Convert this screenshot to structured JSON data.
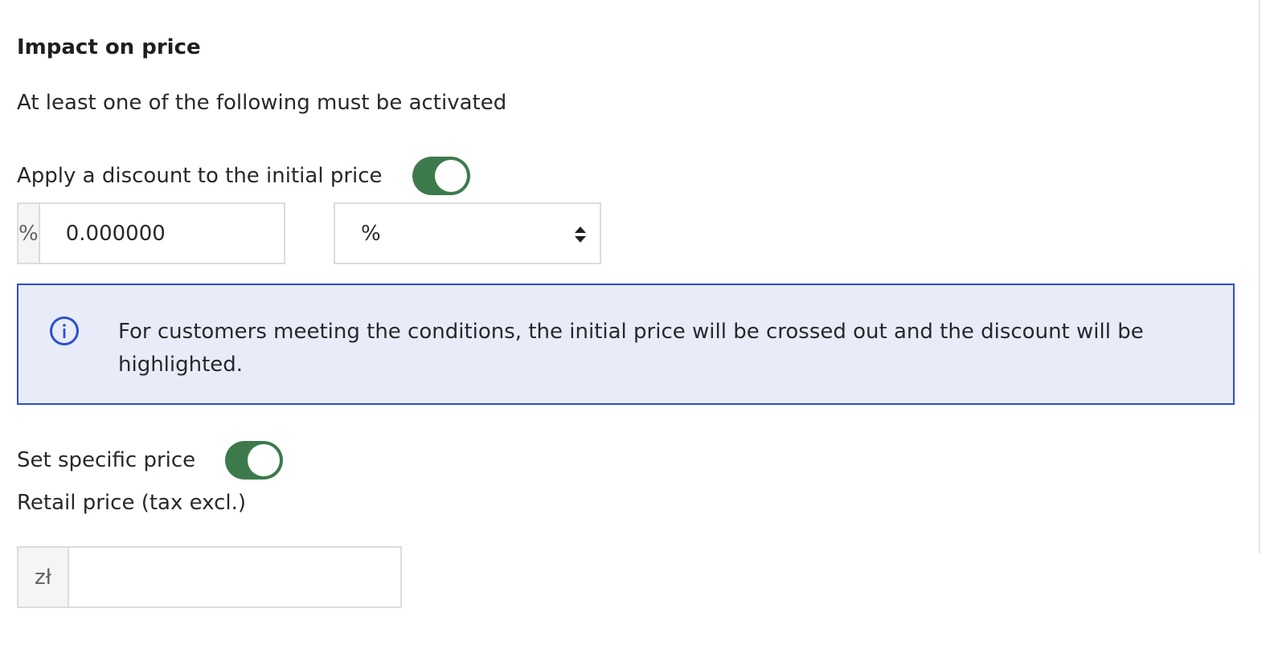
{
  "section": {
    "title": "Impact on price",
    "helper": "At least one of the following must be activated"
  },
  "discount": {
    "label": "Apply a discount to the initial price",
    "enabled": true,
    "addon": "%",
    "value": "0.000000",
    "type_selected": "%"
  },
  "alert": {
    "icon": "info-icon",
    "text": "For customers meeting the conditions, the initial price will be crossed out and the discount will be highlighted."
  },
  "specific_price": {
    "label": "Set specific price",
    "enabled": true,
    "retail_label": "Retail price (tax excl.)",
    "currency": "zł",
    "value": ""
  },
  "colors": {
    "toggle_on": "#3c7a4c",
    "alert_bg": "#e8ecf9",
    "alert_border": "#2d4ecf"
  }
}
